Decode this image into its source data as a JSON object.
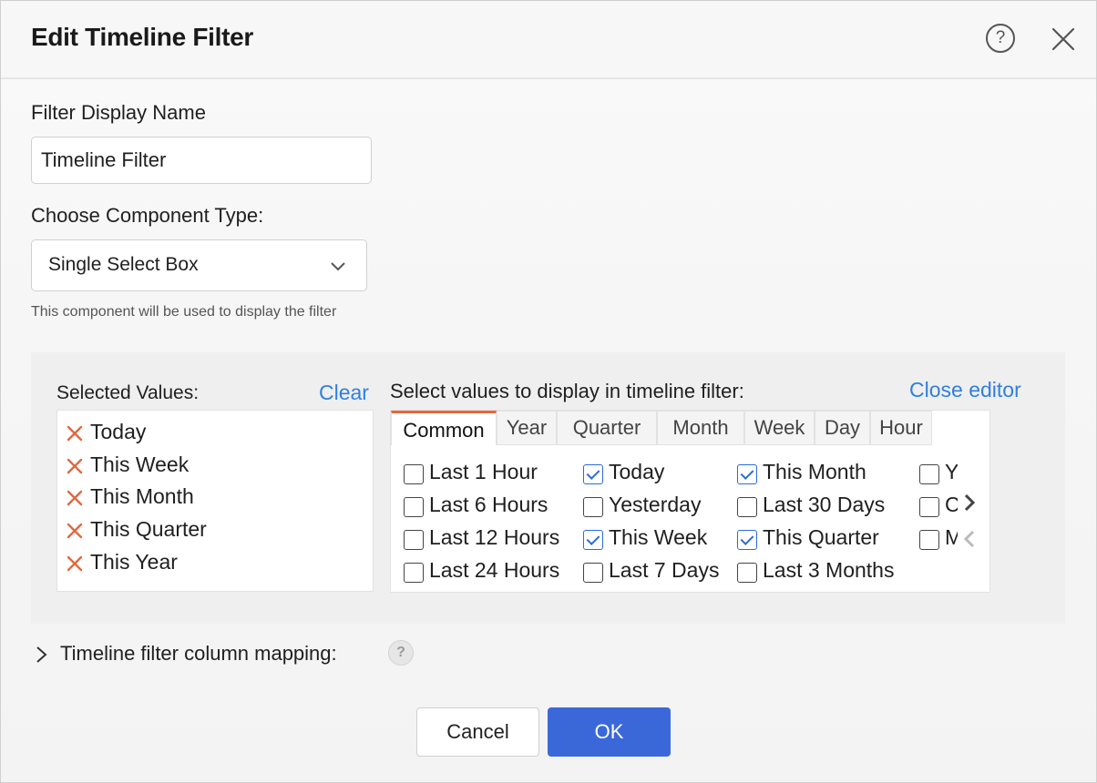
{
  "dialog": {
    "title": "Edit Timeline Filter",
    "help_icon": "question-circle-icon",
    "close_icon": "close-x-icon"
  },
  "display_name": {
    "label": "Filter Display Name",
    "value": "Timeline Filter"
  },
  "component_type": {
    "label": "Choose Component Type:",
    "selected": "Single Select Box",
    "hint": "This component will be used to display the filter"
  },
  "selected_values": {
    "label": "Selected Values:",
    "clear_label": "Clear",
    "items": [
      "Today",
      "This Week",
      "This Month",
      "This Quarter",
      "This Year"
    ]
  },
  "picker": {
    "label": "Select values to display in timeline filter:",
    "close_editor_label": "Close editor",
    "tabs": [
      "Common",
      "Year",
      "Quarter",
      "Month",
      "Week",
      "Day",
      "Hour"
    ],
    "active_tab": "Common",
    "columns": [
      [
        {
          "label": "Last 1 Hour",
          "checked": false
        },
        {
          "label": "Last 6 Hours",
          "checked": false
        },
        {
          "label": "Last 12 Hours",
          "checked": false
        },
        {
          "label": "Last 24 Hours",
          "checked": false
        }
      ],
      [
        {
          "label": "Today",
          "checked": true
        },
        {
          "label": "Yesterday",
          "checked": false
        },
        {
          "label": "This Week",
          "checked": true
        },
        {
          "label": "Last 7 Days",
          "checked": false
        }
      ],
      [
        {
          "label": "This Month",
          "checked": true
        },
        {
          "label": "Last 30 Days",
          "checked": false
        },
        {
          "label": "This Quarter",
          "checked": true
        },
        {
          "label": "Last 3 Months",
          "checked": false
        }
      ],
      [
        {
          "label": "Y",
          "checked": false
        },
        {
          "label": "C",
          "checked": false
        },
        {
          "label": "M",
          "checked": false
        }
      ]
    ]
  },
  "mapping": {
    "label": "Timeline filter column mapping:",
    "help_icon": "question-circle-icon"
  },
  "footer": {
    "cancel_label": "Cancel",
    "ok_label": "OK"
  },
  "colors": {
    "link": "#2f7fe0",
    "primary_button": "#3b68d9",
    "active_tab_accent": "#e8663c",
    "remove_icon": "#e0693f",
    "checkbox_checked": "#2b6bd6"
  }
}
